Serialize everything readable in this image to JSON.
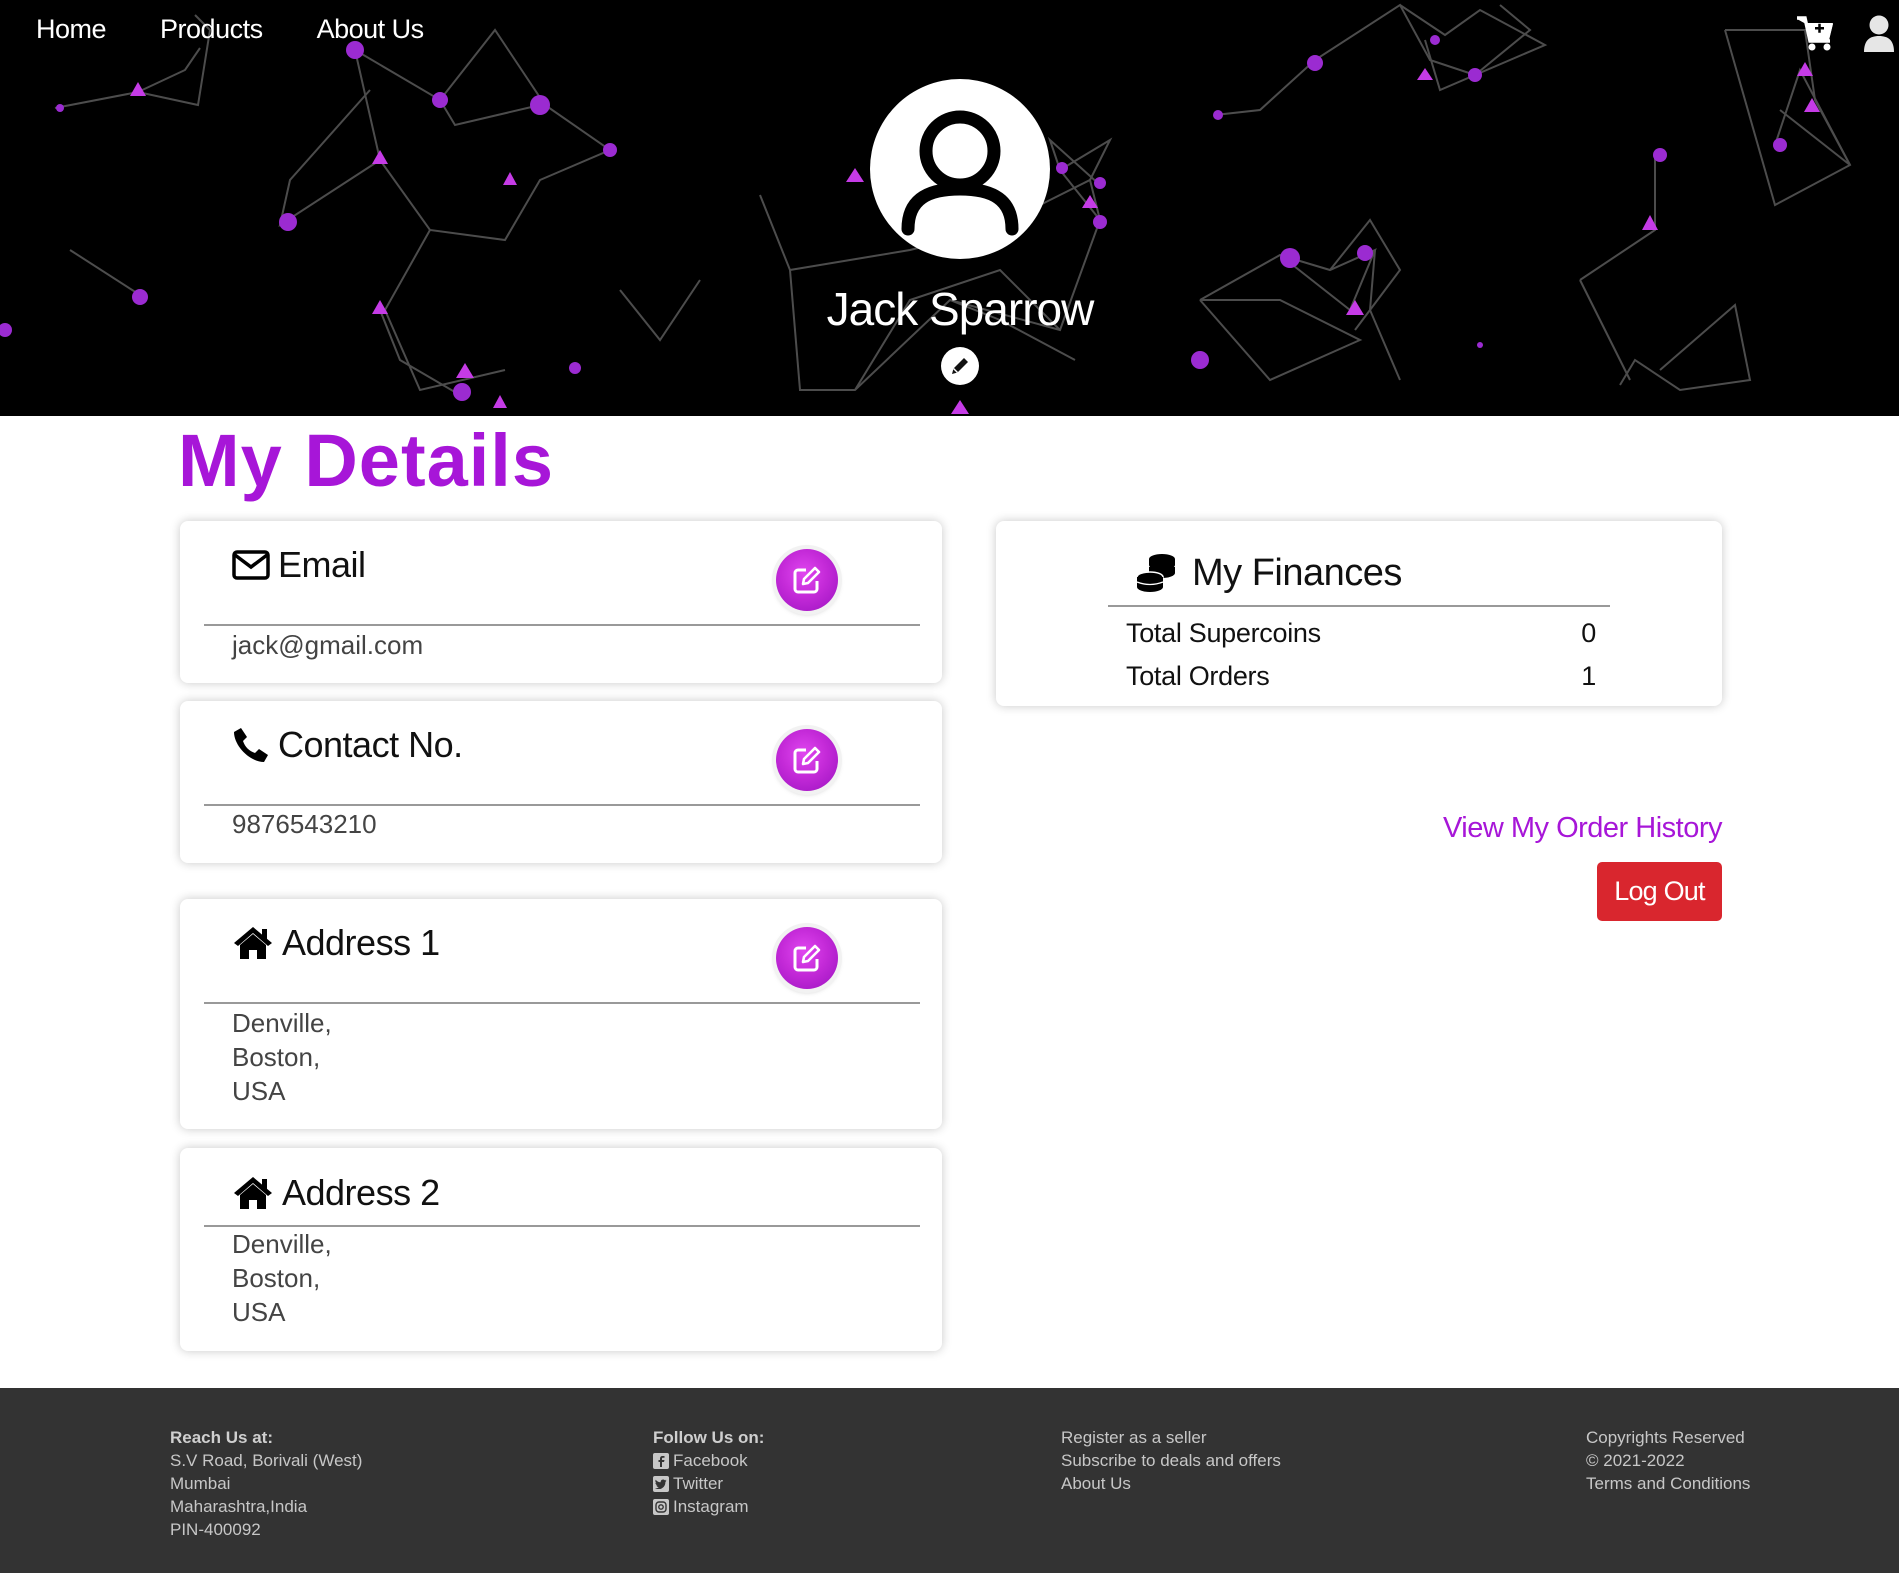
{
  "nav": {
    "items": [
      "Home",
      "Products",
      "About Us"
    ],
    "cart_icon": "cart-plus-icon",
    "user_icon": "user-icon"
  },
  "profile": {
    "name": "Jack Sparrow",
    "avatar_icon": "user-circle-icon",
    "edit_icon": "pencil-icon"
  },
  "page_title": "My Details",
  "cards": {
    "email": {
      "label": "Email",
      "value": "jack@gmail.com",
      "icon": "envelope-icon"
    },
    "contact": {
      "label": "Contact No.",
      "value": "9876543210",
      "icon": "phone-icon"
    },
    "address1": {
      "label": "Address 1",
      "value": "Denville,\nBoston,\nUSA",
      "icon": "home-icon"
    },
    "address2": {
      "label": "Address 2",
      "value": "Denville,\nBoston,\nUSA",
      "icon": "home-icon"
    }
  },
  "finances": {
    "title": "My Finances",
    "icon": "coins-icon",
    "rows": [
      {
        "label": "Total Supercoins",
        "value": "0"
      },
      {
        "label": "Total Orders",
        "value": "1"
      }
    ]
  },
  "actions": {
    "order_history": "View My Order History",
    "logout": "Log Out"
  },
  "footer": {
    "reach": {
      "heading": "Reach Us at:",
      "lines": [
        "S.V Road, Borivali (West)",
        "Mumbai",
        "Maharashtra,India",
        "PIN-400092"
      ]
    },
    "follow": {
      "heading": "Follow Us on:",
      "links": [
        "Facebook",
        "Twitter",
        "Instagram"
      ]
    },
    "links": [
      "Register as a seller",
      "Subscribe to deals and offers",
      "About Us"
    ],
    "legal": [
      "Copyrights Reserved",
      "© 2021-2022",
      "Terms and Conditions"
    ]
  },
  "colors": {
    "accent": "#a716d8",
    "logout": "#d9262e",
    "footer_bg": "#333333",
    "hero_bg": "#000000"
  }
}
